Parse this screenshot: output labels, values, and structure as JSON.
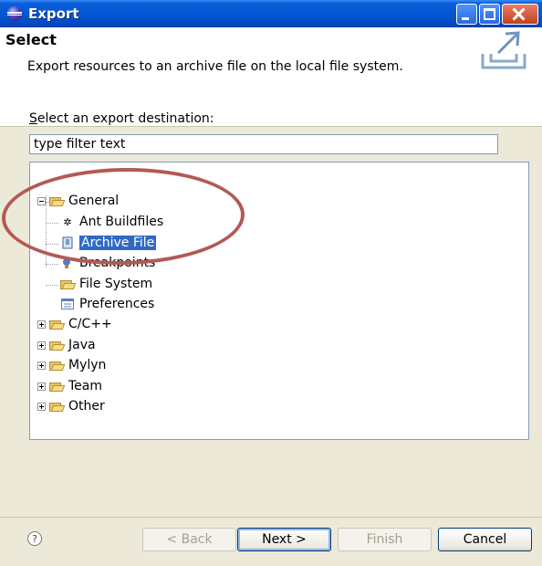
{
  "window": {
    "title": "Export"
  },
  "header": {
    "title": "Select",
    "description": "Export resources to an archive file on the local file system."
  },
  "destination": {
    "label": "Select an export destination:",
    "filter_placeholder": "type filter text"
  },
  "tree": {
    "nodes": [
      {
        "label": "General",
        "expanded": true,
        "icon": "folder-icon"
      },
      {
        "label": "Ant Buildfiles",
        "icon": "ant-icon"
      },
      {
        "label": "Archive File",
        "icon": "archive-icon",
        "selected": true
      },
      {
        "label": "Breakpoints",
        "icon": "breakpoint-icon"
      },
      {
        "label": "File System",
        "icon": "folder-icon"
      },
      {
        "label": "Preferences",
        "icon": "preferences-icon"
      },
      {
        "label": "C/C++",
        "expanded": false,
        "icon": "folder-icon"
      },
      {
        "label": "Java",
        "expanded": false,
        "icon": "folder-icon"
      },
      {
        "label": "Mylyn",
        "expanded": false,
        "icon": "folder-icon"
      },
      {
        "label": "Team",
        "expanded": false,
        "icon": "folder-icon"
      },
      {
        "label": "Other",
        "expanded": false,
        "icon": "folder-icon"
      }
    ]
  },
  "buttons": {
    "back": "< Back",
    "next": "Next >",
    "finish": "Finish",
    "cancel": "Cancel",
    "help_symbol": "?"
  },
  "annotation": {
    "color": "#b35a55"
  },
  "colors": {
    "selection": "#316ac5",
    "titlebar": "#0553d0"
  }
}
